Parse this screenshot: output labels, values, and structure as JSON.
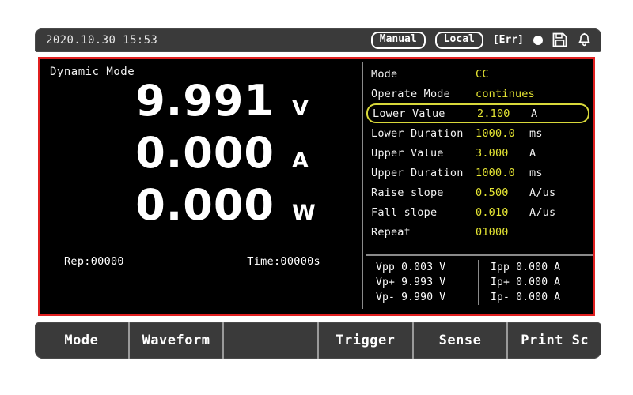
{
  "statusbar": {
    "datetime": "2020.10.30 15:53",
    "control_mode": "Manual",
    "interface_mode": "Local",
    "error_tag": "[Err]",
    "indicator_icon": "filled-circle-icon",
    "save_icon": "floppy-disk-icon",
    "alarm_icon": "bell-icon"
  },
  "display": {
    "mode_label": "Dynamic Mode",
    "readouts": [
      {
        "value": "9.991",
        "unit": "V"
      },
      {
        "value": "0.000",
        "unit": "A"
      },
      {
        "value": "0.000",
        "unit": "W"
      }
    ],
    "repetition": "Rep:00000",
    "elapsed_time": "Time:00000s"
  },
  "parameters": [
    {
      "label": "Mode",
      "value": "CC",
      "unit": "",
      "selected": false
    },
    {
      "label": "Operate Mode",
      "value": "continues",
      "unit": "",
      "selected": false
    },
    {
      "label": "Lower Value",
      "value": "2.100",
      "unit": "A",
      "selected": true
    },
    {
      "label": "Lower Duration",
      "value": "1000.0",
      "unit": "ms",
      "selected": false
    },
    {
      "label": "Upper Value",
      "value": "3.000",
      "unit": "A",
      "selected": false
    },
    {
      "label": "Upper Duration",
      "value": "1000.0",
      "unit": "ms",
      "selected": false
    },
    {
      "label": "Raise slope",
      "value": "0.500",
      "unit": "A/us",
      "selected": false
    },
    {
      "label": "Fall slope",
      "value": "0.010",
      "unit": "A/us",
      "selected": false
    },
    {
      "label": "Repeat",
      "value": "01000",
      "unit": "",
      "selected": false
    }
  ],
  "peak_stats": {
    "voltage": [
      "Vpp 0.003 V",
      "Vp+ 9.993 V",
      "Vp- 9.990 V"
    ],
    "current": [
      "Ipp 0.000 A",
      "Ip+ 0.000 A",
      "Ip- 0.000 A"
    ]
  },
  "function_keys": [
    {
      "label": "Mode"
    },
    {
      "label": "Waveform"
    },
    {
      "label": ""
    },
    {
      "label": "Trigger"
    },
    {
      "label": "Sense"
    },
    {
      "label": "Print Sc"
    }
  ],
  "colors": {
    "screen_border": "#e02020",
    "screen_background": "#000000",
    "value_yellow": "#e5e533",
    "label_white": "#f2f2f2",
    "chrome_gray": "#3a3a3a",
    "highlight_outline": "#d8d83a"
  }
}
